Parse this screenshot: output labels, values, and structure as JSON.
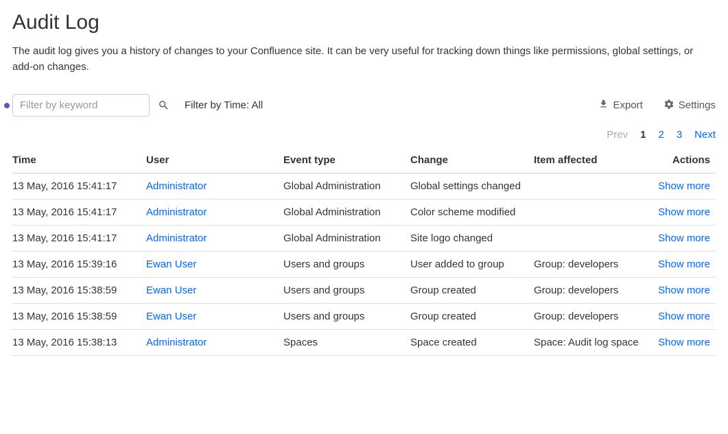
{
  "page": {
    "title": "Audit Log",
    "description": "The audit log gives you a history of changes to your Confluence site. It can be very useful for tracking down things like permissions, global settings, or add-on changes."
  },
  "toolbar": {
    "filter_placeholder": "Filter by keyword",
    "time_filter_label": "Filter by Time: All",
    "export_label": "Export",
    "settings_label": "Settings"
  },
  "pagination": {
    "prev": "Prev",
    "pages": [
      "1",
      "2",
      "3"
    ],
    "current": "1",
    "next": "Next"
  },
  "table": {
    "headers": {
      "time": "Time",
      "user": "User",
      "event_type": "Event type",
      "change": "Change",
      "item_affected": "Item affected",
      "actions": "Actions"
    },
    "show_more_label": "Show more",
    "rows": [
      {
        "time": "13 May, 2016 15:41:17",
        "user": "Administrator",
        "event_type": "Global Administration",
        "change": "Global settings changed",
        "item_affected": ""
      },
      {
        "time": "13 May, 2016 15:41:17",
        "user": "Administrator",
        "event_type": "Global Administration",
        "change": "Color scheme modified",
        "item_affected": ""
      },
      {
        "time": "13 May, 2016 15:41:17",
        "user": "Administrator",
        "event_type": "Global Administration",
        "change": "Site logo changed",
        "item_affected": ""
      },
      {
        "time": "13 May, 2016 15:39:16",
        "user": "Ewan User",
        "event_type": "Users and groups",
        "change": "User added to group",
        "item_affected": "Group: developers"
      },
      {
        "time": "13 May, 2016 15:38:59",
        "user": "Ewan User",
        "event_type": "Users and groups",
        "change": "Group created",
        "item_affected": "Group: developers"
      },
      {
        "time": "13 May, 2016 15:38:59",
        "user": "Ewan User",
        "event_type": "Users and groups",
        "change": "Group created",
        "item_affected": "Group: developers"
      },
      {
        "time": "13 May, 2016 15:38:13",
        "user": "Administrator",
        "event_type": "Spaces",
        "change": "Space created",
        "item_affected": "Space: Audit log space"
      }
    ]
  }
}
